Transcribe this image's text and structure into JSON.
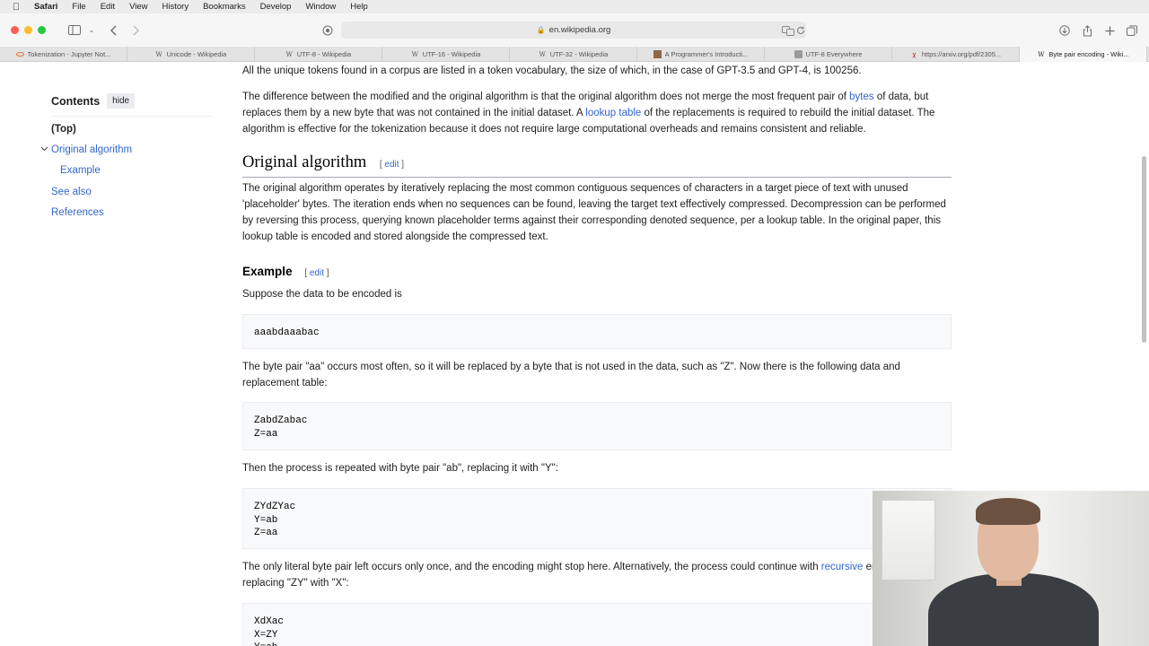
{
  "menubar": {
    "app": "Safari",
    "items": [
      "File",
      "Edit",
      "View",
      "History",
      "Bookmarks",
      "Develop",
      "Window",
      "Help"
    ]
  },
  "toolbar": {
    "address": "en.wikipedia.org"
  },
  "tabs": [
    {
      "label": "Tokenization - Jupyter Not...",
      "icon": "jupyter-icon"
    },
    {
      "label": "Unicode - Wikipedia",
      "icon": "wikipedia-icon"
    },
    {
      "label": "UTF-8 - Wikipedia",
      "icon": "wikipedia-icon"
    },
    {
      "label": "UTF-16 - Wikipedia",
      "icon": "wikipedia-icon"
    },
    {
      "label": "UTF-32 - Wikipedia",
      "icon": "wikipedia-icon"
    },
    {
      "label": "A Programmer's Introducti...",
      "icon": "article-icon"
    },
    {
      "label": "UTF-8 Everywhere",
      "icon": "utf8everywhere-icon"
    },
    {
      "label": "https://arxiv.org/pdf/2305...",
      "icon": "arxiv-icon"
    },
    {
      "label": "Byte pair encoding - Wiki...",
      "icon": "wikipedia-icon",
      "active": true
    }
  ],
  "toc": {
    "title": "Contents",
    "hide": "hide",
    "items": {
      "top": "(Top)",
      "original": "Original algorithm",
      "example": "Example",
      "see_also": "See also",
      "references": "References"
    }
  },
  "article": {
    "p0": "All the unique tokens found in a corpus are listed in a token vocabulary, the size of which, in the case of GPT-3.5 and GPT-4, is 100256.",
    "p1": {
      "a": "The difference between the modified and the original algorithm is that the original algorithm does not merge the most frequent pair of ",
      "link1": "bytes",
      "b": " of data, but replaces them by a new byte that was not contained in the initial dataset. A ",
      "link2": "lookup table",
      "c": " of the replacements is required to rebuild the initial dataset. The algorithm is effective for the tokenization because it does not require large computational overheads and remains consistent and reliable."
    },
    "h_original": "Original algorithm",
    "edit": "edit",
    "p2": "The original algorithm operates by iteratively replacing the most common contiguous sequences of characters in a target piece of text with unused 'placeholder' bytes. The iteration ends when no sequences can be found, leaving the target text effectively compressed. Decompression can be performed by reversing this process, querying known placeholder terms against their corresponding denoted sequence, per a lookup table. In the original paper, this lookup table is encoded and stored alongside the compressed text.",
    "h_example": "Example",
    "p3": "Suppose the data to be encoded is",
    "code1": "aaabdaaabac",
    "p4": "The byte pair \"aa\" occurs most often, so it will be replaced by a byte that is not used in the data, such as \"Z\". Now there is the following data and replacement table:",
    "code2": "ZabdZabac\nZ=aa",
    "p5": "Then the process is repeated with byte pair \"ab\", replacing it with \"Y\":",
    "code3": "ZYdZYac\nY=ab\nZ=aa",
    "p6": {
      "a": "The only literal byte pair left occurs only once, and the encoding might stop here. Alternatively, the process could continue with ",
      "link": "recursive",
      "b": " encoding, replacing \"ZY\" with \"X\":"
    },
    "code4": "XdXac\nX=ZY\nY=ab"
  }
}
